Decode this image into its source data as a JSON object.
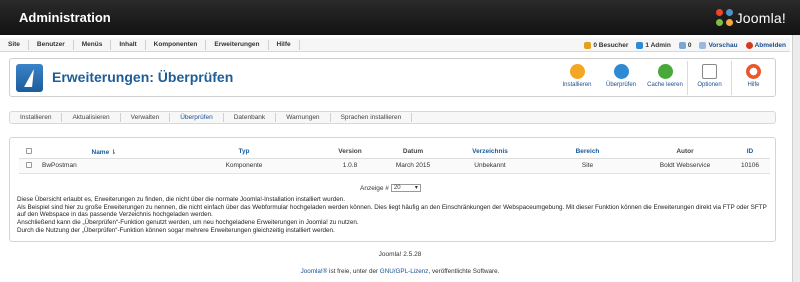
{
  "top": {
    "title": "Administration",
    "brand": "Joomla!"
  },
  "menu": [
    "Site",
    "Benutzer",
    "Menüs",
    "Inhalt",
    "Komponenten",
    "Erweiterungen",
    "Hilfe"
  ],
  "status": {
    "visitors": "0 Besucher",
    "admins": "1 Admin",
    "messages": "0",
    "preview": "Vorschau",
    "logout": "Abmelden"
  },
  "header": {
    "title": "Erweiterungen: Überprüfen",
    "toolbar": {
      "install": "Installieren",
      "check": "Überprüfen",
      "clear_cache": "Cache leeren",
      "options": "Optionen",
      "help": "Hilfe"
    }
  },
  "tabs": [
    "Installieren",
    "Aktualisieren",
    "Verwalten",
    "Überprüfen",
    "Datenbank",
    "Warnungen",
    "Sprachen installieren"
  ],
  "table": {
    "headers": {
      "name": "Name",
      "type": "Typ",
      "version": "Version",
      "date": "Datum",
      "folder": "Verzeichnis",
      "client": "Bereich",
      "author": "Autor",
      "id": "ID"
    },
    "rows": [
      {
        "name": "BwPostman",
        "type": "Komponente",
        "version": "1.0.8",
        "date": "March 2015",
        "folder": "Unbekannt",
        "client": "Site",
        "author": "Boldt Webservice",
        "id": "10106"
      }
    ]
  },
  "pager": {
    "label": "Anzeige #",
    "value": "20"
  },
  "info": [
    "Diese Übersicht erlaubt es, Erweiterungen zu finden, die nicht über die normale Joomla!-Installation installiert wurden.",
    "Als Beispiel sind hier zu große Erweiterungen zu nennen, die nicht einfach über das Webformular hochgeladen werden können. Dies liegt häufig an den Einschränkungen der Webspaceumgebung. Mit dieser Funktion können die Erweiterungen direkt via FTP oder SFTP auf den Webspace in das passende Verzeichnis hochgeladen werden.",
    "Anschließend kann die „Überprüfen“-Funktion genutzt werden, um neu hochgeladene Erweiterungen in Joomla! zu nutzen.",
    "Durch die Nutzung der „Überprüfen“-Funktion können sogar mehrere Erweiterungen gleichzeitig installiert werden."
  ],
  "footer": {
    "version": "Joomla! 2.5.28",
    "license_brand": "Joomla!®",
    "license_mid": " ist freie, unter der ",
    "license_link": "GNU/GPL-Lizenz",
    "license_end": ", veröffentlichte Software."
  }
}
